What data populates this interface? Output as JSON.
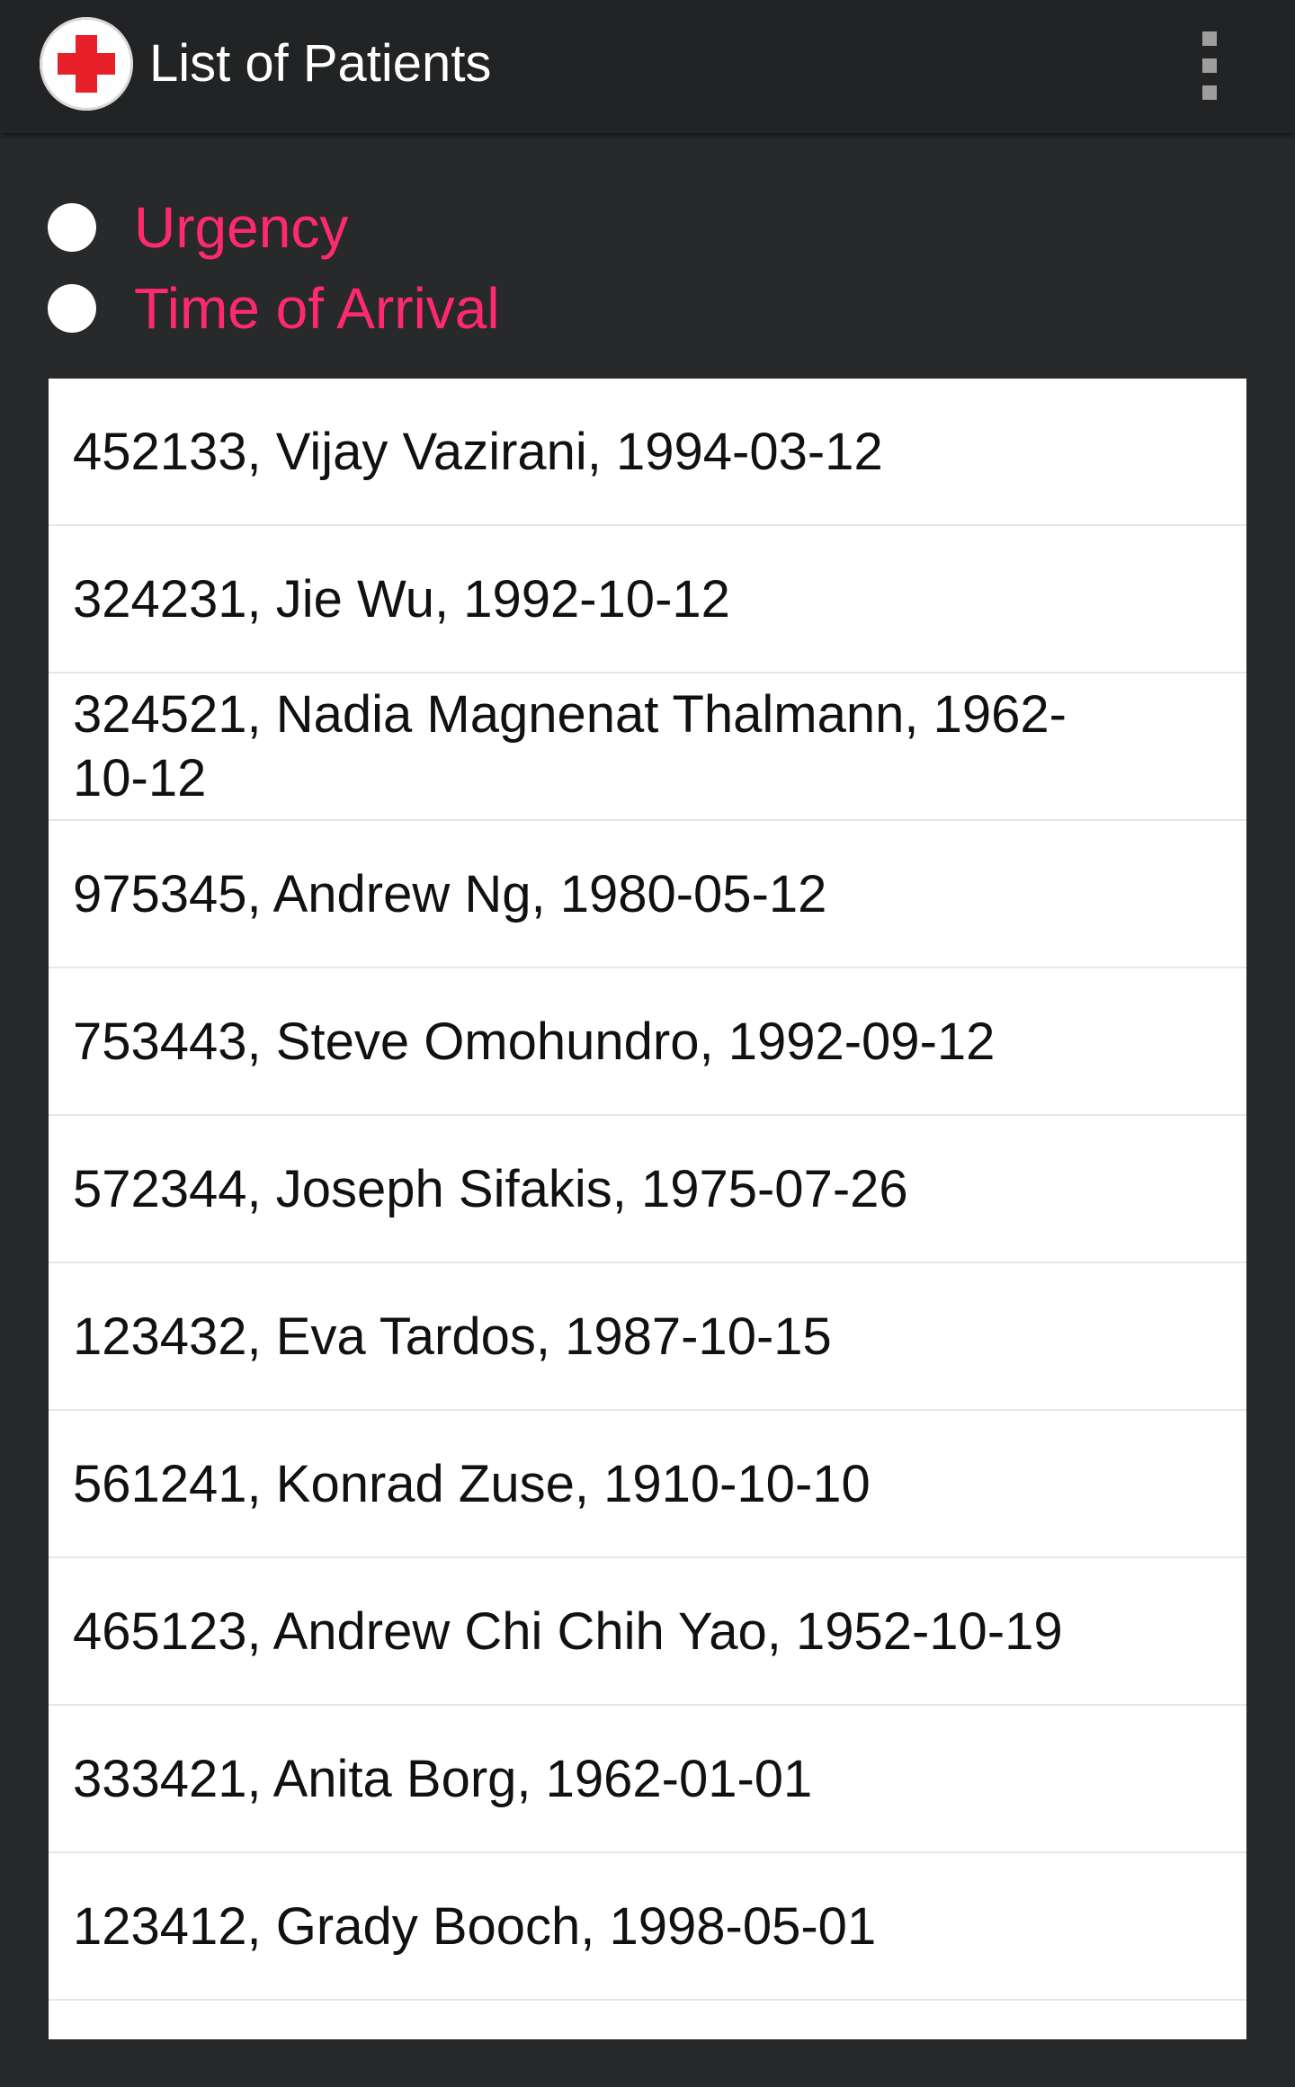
{
  "app_bar": {
    "title": "List of Patients",
    "logo_icon": "red-cross-icon",
    "menu_icon": "overflow-menu-icon",
    "logo_color": "#e8202a"
  },
  "sort_options": [
    {
      "label": "Urgency",
      "selected": false
    },
    {
      "label": "Time of Arrival",
      "selected": false
    }
  ],
  "colors": {
    "accent": "#ff2a6d",
    "background": "#27292b",
    "app_bar": "#222324",
    "list_background": "#ffffff"
  },
  "patients": [
    {
      "text": "452133, Vijay Vazirani, 1994-03-12"
    },
    {
      "text": "324231, Jie Wu, 1992-10-12"
    },
    {
      "text": "324521, Nadia Magnenat Thalmann, 1962-10-12"
    },
    {
      "text": "975345, Andrew Ng, 1980-05-12"
    },
    {
      "text": "753443, Steve Omohundro, 1992-09-12"
    },
    {
      "text": "572344, Joseph Sifakis, 1975-07-26"
    },
    {
      "text": "123432, Eva Tardos, 1987-10-15"
    },
    {
      "text": "561241, Konrad Zuse, 1910-10-10"
    },
    {
      "text": "465123, Andrew Chi Chih Yao, 1952-10-19"
    },
    {
      "text": "333421, Anita Borg, 1962-01-01"
    },
    {
      "text": "123412, Grady Booch, 1998-05-01"
    }
  ]
}
